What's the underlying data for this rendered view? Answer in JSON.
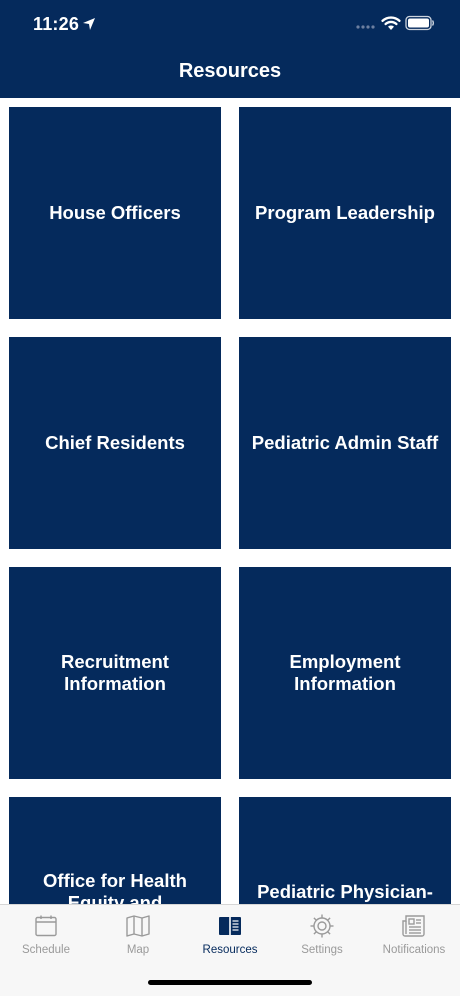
{
  "status_bar": {
    "time": "11:26"
  },
  "header": {
    "title": "Resources"
  },
  "tiles": [
    {
      "label": "House Officers"
    },
    {
      "label": "Program Leadership"
    },
    {
      "label": "Chief Residents"
    },
    {
      "label": "Pediatric Admin Staff"
    },
    {
      "label": "Recruitment Information"
    },
    {
      "label": "Employment Information"
    },
    {
      "label": "Office for Health Equity and Inclusion"
    },
    {
      "label": "Pediatric Physician-Scientist Training"
    }
  ],
  "tabbar": {
    "active": "Resources",
    "tabs": [
      {
        "label": "Schedule",
        "icon": "calendar-icon"
      },
      {
        "label": "Map",
        "icon": "map-icon"
      },
      {
        "label": "Resources",
        "icon": "book-icon"
      },
      {
        "label": "Settings",
        "icon": "gear-icon"
      },
      {
        "label": "Notifications",
        "icon": "newspaper-icon"
      }
    ]
  },
  "colors": {
    "brand": "#052a5c",
    "inactive": "#9a9a9a",
    "tabbar_bg": "#f7f7f7"
  }
}
